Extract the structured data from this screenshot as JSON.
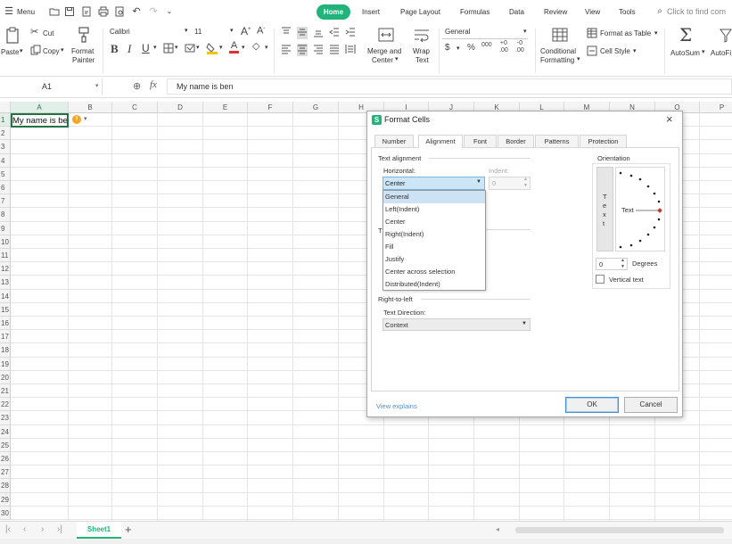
{
  "menu": {
    "menu_label": "Menu",
    "tabs": [
      "Home",
      "Insert",
      "Page Layout",
      "Formulas",
      "Data",
      "Review",
      "View",
      "Tools"
    ],
    "search_placeholder": "Click to find com"
  },
  "ribbon": {
    "paste": "Paste",
    "cut": "Cut",
    "copy": "Copy",
    "format_painter_1": "Format",
    "format_painter_2": "Painter",
    "font_name": "Calibri",
    "font_size": "11",
    "merge_1": "Merge and",
    "merge_2": "Center",
    "wrap_1": "Wrap",
    "wrap_2": "Text",
    "number_format": "General",
    "conditional_1": "Conditional",
    "conditional_2": "Formatting",
    "format_as_table": "Format as Table",
    "cell_style": "Cell Style",
    "autosum": "AutoSum",
    "autofilter": "AutoFi"
  },
  "formula_bar": {
    "cell_ref": "A1",
    "fx": "fx",
    "content": "My name is ben"
  },
  "grid": {
    "columns": [
      "A",
      "B",
      "C",
      "D",
      "E",
      "F",
      "G",
      "H",
      "I",
      "J",
      "K",
      "L",
      "M",
      "N",
      "O",
      "P"
    ],
    "rows": [
      "1",
      "2",
      "3",
      "4",
      "5",
      "6",
      "7",
      "8",
      "9",
      "10",
      "11",
      "12",
      "13",
      "14",
      "15",
      "16",
      "17",
      "18",
      "19",
      "20",
      "21",
      "22",
      "23",
      "24",
      "25",
      "26",
      "27",
      "28",
      "29",
      "30"
    ],
    "a1_value": "My name is be"
  },
  "sheets": {
    "active": "Sheet1",
    "add": "+"
  },
  "dialog": {
    "title": "Format Cells",
    "tabs": [
      "Number",
      "Alignment",
      "Font",
      "Border",
      "Patterns",
      "Protection"
    ],
    "text_alignment_group": "Text alignment",
    "horizontal_label": "Horizontal:",
    "horizontal_value": "Center",
    "indent_label": "Indent:",
    "indent_value": "0",
    "dropdown_options": [
      "General",
      "Left(Indent)",
      "Center",
      "Right(Indent)",
      "Fill",
      "Justify",
      "Center across selection",
      "Distributed(Indent)"
    ],
    "highlighted_option": "General",
    "orientation_group": "Orientation",
    "vertical_text_letters": [
      "T",
      "e",
      "x",
      "t"
    ],
    "orientation_text": "Text",
    "degrees_value": "0",
    "degrees_label": "Degrees",
    "vertical_text_label": "Vertical text",
    "rtl_group": "Right-to-left",
    "text_direction_label": "Text Direction:",
    "text_direction_value": "Context",
    "view_explains": "View explains",
    "ok": "OK",
    "cancel": "Cancel"
  },
  "colors": {
    "accent": "#21b47a",
    "selected_cell_border": "#217346",
    "dropdown_highlight": "#cde2f5",
    "field_focus": "#cde6f7",
    "link": "#4a90d9"
  }
}
